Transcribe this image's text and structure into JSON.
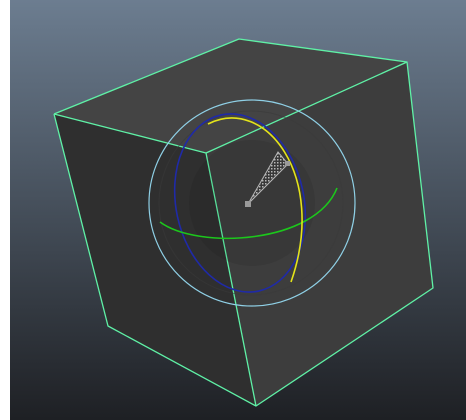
{
  "viewport": {
    "background_top": "#6c7d90",
    "background_bottom": "#1e2024",
    "scene": {
      "object": "cube",
      "selected": true,
      "wireframe_color": "#5ff1a6",
      "face_colors": {
        "top": "#444444",
        "front_left": "#2f2f2f",
        "front_right": "#3d3d3d"
      }
    },
    "rotate_manipulator": {
      "active_tool": "rotate",
      "colors": {
        "view_ring": "#8fd0e6",
        "x_axis": "#1f2aa8",
        "y_axis": "#1cc71c",
        "z_axis": "#e4e41a",
        "pivot": "#9a9a9a",
        "interaction_wedge": "#b8b8b8"
      }
    }
  }
}
